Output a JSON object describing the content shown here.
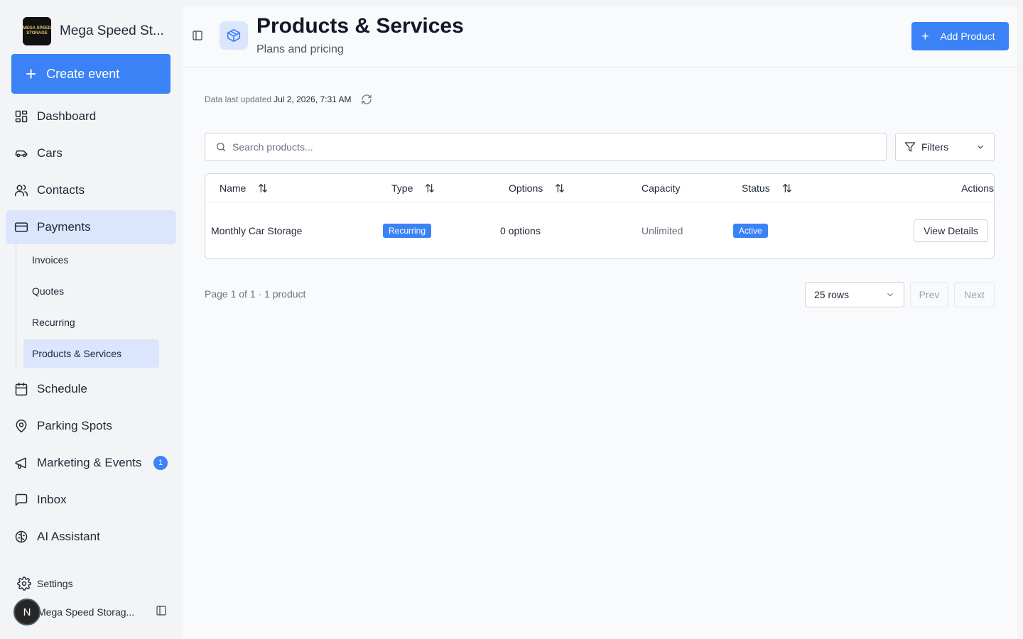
{
  "sidebar": {
    "brand": {
      "name": "Mega Speed St...",
      "logo_text": "MEGA SPEED STORAGE"
    },
    "create_button": "Create event",
    "nav": [
      {
        "label": "Dashboard",
        "icon": "dashboard-icon"
      },
      {
        "label": "Cars",
        "icon": "car-icon"
      },
      {
        "label": "Contacts",
        "icon": "users-icon"
      },
      {
        "label": "Payments",
        "icon": "credit-card-icon",
        "active": true
      },
      {
        "label": "Schedule",
        "icon": "calendar-icon"
      },
      {
        "label": "Parking Spots",
        "icon": "map-pin-icon"
      },
      {
        "label": "Marketing & Events",
        "icon": "megaphone-icon",
        "badge": "1"
      },
      {
        "label": "Inbox",
        "icon": "message-square-icon"
      },
      {
        "label": "AI Assistant",
        "icon": "brain-icon"
      }
    ],
    "payments_sub": [
      {
        "label": "Invoices"
      },
      {
        "label": "Quotes"
      },
      {
        "label": "Recurring"
      },
      {
        "label": "Products & Services",
        "active": true
      }
    ],
    "settings_label": "Settings",
    "user": {
      "initial": "N",
      "name": "Mega Speed Storag..."
    }
  },
  "header": {
    "title": "Products & Services",
    "subtitle": "Plans and pricing",
    "add_button": "Add Product"
  },
  "status": {
    "updated_label": "Data last updated",
    "updated_value": "Jul 2, 2026, 7:31 AM"
  },
  "search": {
    "placeholder": "Search products..."
  },
  "filters_label": "Filters",
  "table": {
    "columns": [
      "Name",
      "Type",
      "Options",
      "Capacity",
      "Status",
      "Actions"
    ],
    "rows": [
      {
        "name": "Monthly Car Storage",
        "type": "Recurring",
        "options": "0 options",
        "capacity": "Unlimited",
        "status": "Active",
        "action": "View Details"
      }
    ]
  },
  "pagination": {
    "info": "Page 1 of 1 · 1 product",
    "rows_per_page": "25 rows",
    "prev": "Prev",
    "next": "Next"
  },
  "colors": {
    "accent": "#3b82f6",
    "active_bg": "#dbe5fc"
  }
}
